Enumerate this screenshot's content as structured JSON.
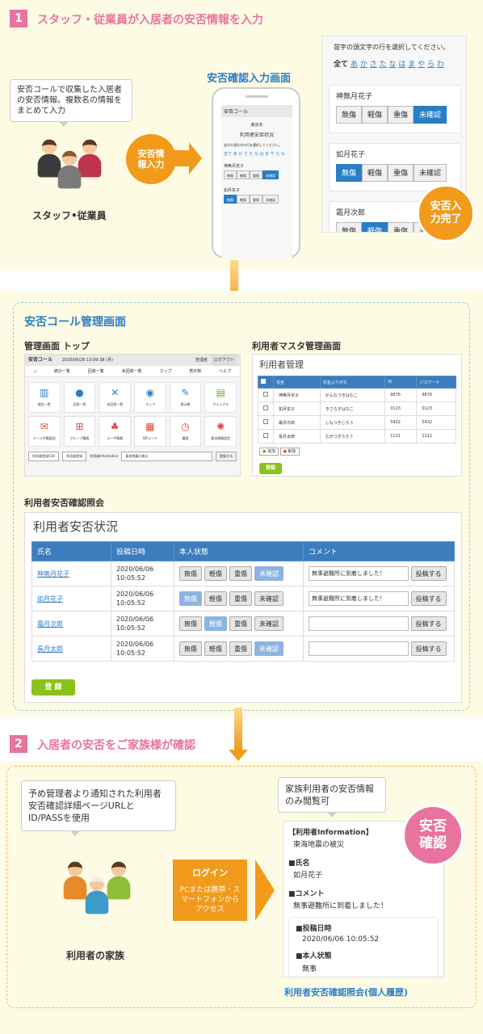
{
  "step1": {
    "num": "1",
    "title": "スタッフ・従業員が入居者の安否情報を入力"
  },
  "staff": {
    "bubble": "安否コールで収集した入居者の安否情報。複数名の情報をまとめて入力",
    "label": "スタッフ•従業員"
  },
  "flow1": {
    "circle": "安否情報入力",
    "screen_title": "安否確認入力画面"
  },
  "phone": {
    "brand": "安否コール",
    "facility": "東京本",
    "title": "利用者安否状況",
    "hint": "苗字の頭文字の行を選択してください。",
    "kana": "全て あ か さ た な は ま や ら わ",
    "p1": "神無月花子",
    "p2": "如月花子",
    "btns": [
      "無傷",
      "軽傷",
      "重傷",
      "未確認"
    ]
  },
  "zoom": {
    "hint": "苗字の頭文字の行を選択してください。",
    "kana_all": "全て",
    "kana": [
      "あ",
      "か",
      "さ",
      "た",
      "な",
      "は",
      "ま",
      "や",
      "ら",
      "わ"
    ],
    "persons": [
      {
        "name": "神無月花子",
        "sel": 3
      },
      {
        "name": "如月花子",
        "sel": 0
      },
      {
        "name": "霜月次郎",
        "sel": 1
      }
    ],
    "btns": [
      "無傷",
      "軽傷",
      "重傷",
      "未確認"
    ]
  },
  "complete": "安否入力完了",
  "mgmt": {
    "title": "安否コール管理画面",
    "top_label": "管理画面 トップ",
    "master_label": "利用者マスタ管理画面",
    "status_label": "利用者安否確認照会"
  },
  "top": {
    "logo": "安否コール",
    "date": "2020/06/26 13:09:38 (月)",
    "user": "管理者",
    "logout": "ログアウト",
    "nav": [
      "統計一覧",
      "回答一覧",
      "未回答一覧",
      "マップ",
      "表示数",
      "ヘルプ"
    ],
    "tiles": [
      "統計一覧",
      "回答一覧",
      "未回答一覧",
      "マップ",
      "表示数",
      "マニュアル",
      "メール手動配信",
      "グループ情報",
      "ユーザ情報",
      "QRコード",
      "履歴",
      "基本情報設定"
    ],
    "b1": "利用者登録CSV",
    "b2": "利用者登録",
    "info": "利用者Information",
    "info_val": "東海地震の被災",
    "b3": "登録する"
  },
  "master": {
    "title": "利用者管理",
    "headers": [
      "氏名",
      "氏名ふりがな",
      "ID",
      "パスワード"
    ],
    "rows": [
      [
        "神無月花子",
        "かんなづきはなこ",
        "9876",
        "9876"
      ],
      [
        "如月花子",
        "きさらぎはなこ",
        "0123",
        "0123"
      ],
      [
        "霜月次郎",
        "しもつきじろう",
        "5432",
        "5432"
      ],
      [
        "長月太郎",
        "ながつきたろう",
        "1111",
        "1111"
      ]
    ],
    "add": "追加",
    "del": "削除",
    "save": "登録"
  },
  "status": {
    "title": "利用者安否状況",
    "headers": [
      "氏名",
      "投稿日時",
      "本人状態",
      "コメント"
    ],
    "btns": [
      "無傷",
      "軽傷",
      "重傷",
      "未確認"
    ],
    "post": "投稿する",
    "rows": [
      {
        "name": "神無月花子",
        "date": "2020/06/06",
        "time": "10:05:52",
        "sel": 3,
        "comment": "無事避難所に到着しました！"
      },
      {
        "name": "如月花子",
        "date": "2020/06/06",
        "time": "10:05:52",
        "sel": 0,
        "comment": "無事避難所に到着しました！"
      },
      {
        "name": "霜月次郎",
        "date": "2020/06/06",
        "time": "10:05:52",
        "sel": 1,
        "comment": ""
      },
      {
        "name": "長月太郎",
        "date": "2020/06/06",
        "time": "10:05:52",
        "sel": 3,
        "comment": ""
      }
    ],
    "save": "登 録"
  },
  "step2": {
    "num": "2",
    "title": "入居者の安否をご家族様が確認"
  },
  "family": {
    "bubble": "予め管理者より通知された利用者安否確認詳細ページURLとID/PASSを使用",
    "label": "利用者の家族"
  },
  "login": {
    "title": "ログイン",
    "sub": "PCまたは携帯・スマートフォンからアクセス"
  },
  "view": {
    "bubble": "家族利用者の安否情報のみ閲覧可",
    "info_h": "【利用者Information】",
    "info_v": "東海地震の被災",
    "name_h": "■氏名",
    "name_v": "如月花子",
    "comment_h": "■コメント",
    "comment_v": "無事避難所に到着しました！",
    "date_h": "■投稿日時",
    "date_v": "2020/06/06 10:05:52",
    "state_h": "■本人状態",
    "state_v": "無事",
    "stamp": "安否確認",
    "caption": "利用者安否確認照会(個人履歴)"
  },
  "colors": {
    "pink": "#e8739e",
    "blue": "#2a7ec7",
    "orange": "#f29a1b",
    "green": "#8bc21c",
    "bg": "#fdfbe4"
  }
}
